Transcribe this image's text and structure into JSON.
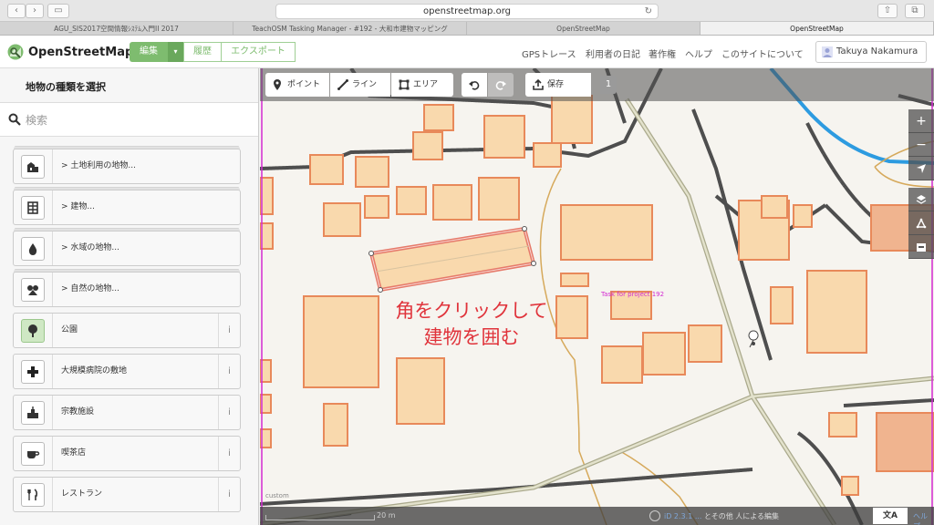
{
  "browser": {
    "url": "openstreetmap.org",
    "tabs": [
      {
        "title": "AGU_SIS2017空間情報ｼｽﾃﾑ入門II 2017",
        "active": false
      },
      {
        "title": "TeachOSM Tasking Manager - #192 - 大和市建物マッピング",
        "active": false
      },
      {
        "title": "OpenStreetMap",
        "active": false
      },
      {
        "title": "OpenStreetMap",
        "active": true
      }
    ]
  },
  "header": {
    "logo_text": "OpenStreetMap",
    "edit_label": "編集",
    "history_label": "履歴",
    "export_label": "エクスポート",
    "links": [
      "GPSトレース",
      "利用者の日記",
      "著作権",
      "ヘルプ",
      "このサイトについて"
    ],
    "user_name": "Takuya Nakamura"
  },
  "sidebar": {
    "title": "地物の種類を選択",
    "search_placeholder": "検索",
    "presets": [
      {
        "label": "> 土地利用の地物...",
        "icon": "land-use-icon",
        "category": true
      },
      {
        "label": "> 建物...",
        "icon": "building-icon",
        "category": true
      },
      {
        "label": "> 水域の地物...",
        "icon": "water-drop-icon",
        "category": true
      },
      {
        "label": "> 自然の地物...",
        "icon": "nature-icon",
        "category": true
      },
      {
        "label": "公園",
        "icon": "tree-icon",
        "category": false
      },
      {
        "label": "大規模病院の敷地",
        "icon": "hospital-cross-icon",
        "category": false
      },
      {
        "label": "宗教施設",
        "icon": "place-of-worship-icon",
        "category": false
      },
      {
        "label": "喫茶店",
        "icon": "cafe-cup-icon",
        "category": false
      },
      {
        "label": "レストラン",
        "icon": "restaurant-icon",
        "category": false
      }
    ],
    "info_glyph": "i"
  },
  "toolbar": {
    "point_label": "ポイント",
    "line_label": "ライン",
    "area_label": "エリア",
    "save_label": "保存",
    "edit_count": "1"
  },
  "map": {
    "annotation_line1": "角をクリックして",
    "annotation_line2": "建物を囲む",
    "task_label": "Task for project 192",
    "custom_label": "custom",
    "scale_label": "20 m",
    "attribution_link": "iD 2.3.1 ...",
    "attribution_text": "とその他 人による編集",
    "lang_label": "文A",
    "help_link": "ヘルプ"
  },
  "colors": {
    "osm_green": "#7ebc6f",
    "building_fill": "#f9d9ad",
    "building_stroke": "#e8895a",
    "annotation_red": "#e0333b",
    "task_magenta": "#d32ad2",
    "river_blue": "#2d9be0"
  }
}
